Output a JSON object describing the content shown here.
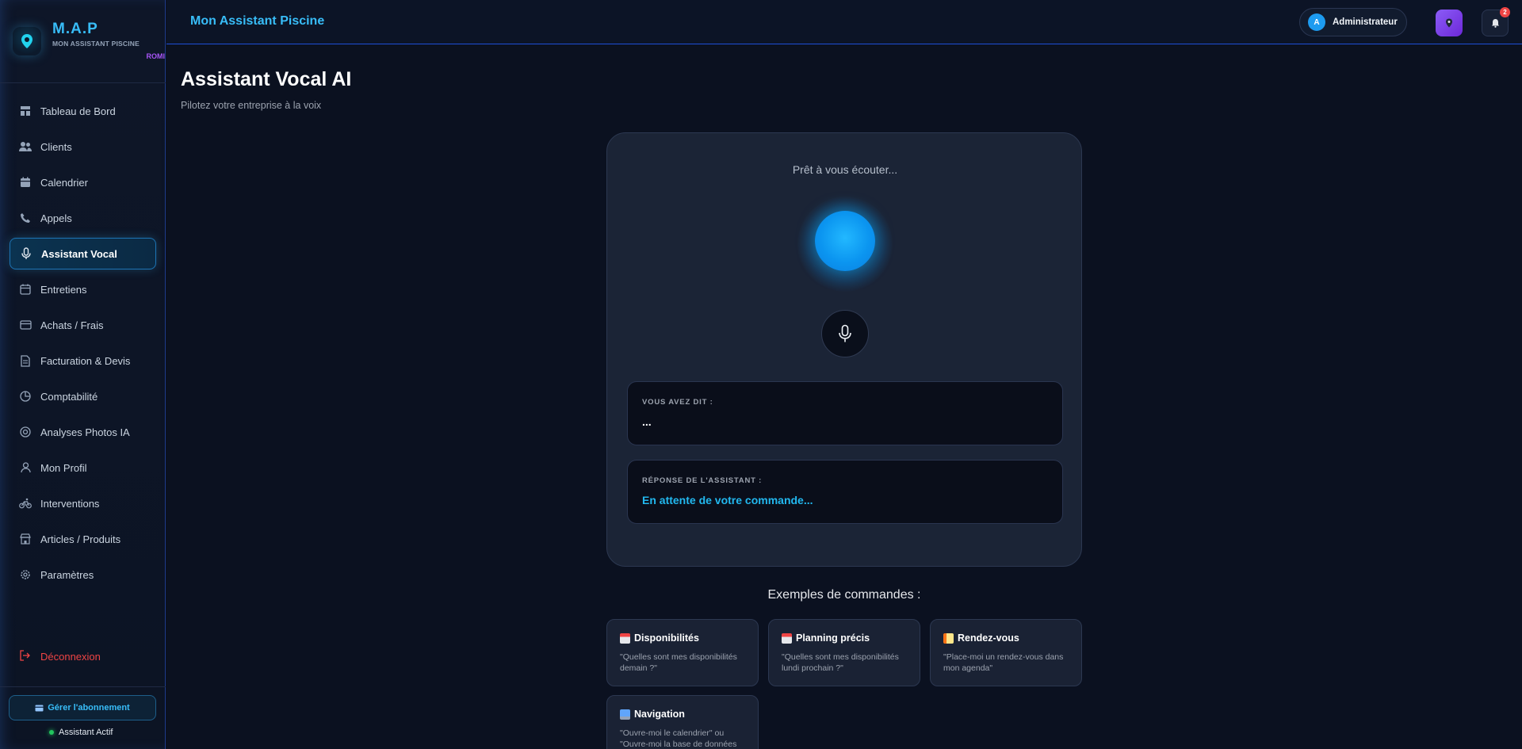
{
  "brand": {
    "title": "M.A.P",
    "subtitle": "MON ASSISTANT PISCINE",
    "tag": "ROMI"
  },
  "sidebar": {
    "items": [
      {
        "label": "Tableau de Bord",
        "icon": "dashboard-icon"
      },
      {
        "label": "Clients",
        "icon": "users-icon"
      },
      {
        "label": "Calendrier",
        "icon": "calendar-icon"
      },
      {
        "label": "Appels",
        "icon": "phone-icon"
      },
      {
        "label": "Assistant Vocal",
        "icon": "microphone-icon",
        "active": true
      },
      {
        "label": "Entretiens",
        "icon": "calendar-grid-icon"
      },
      {
        "label": "Achats / Frais",
        "icon": "credit-card-icon"
      },
      {
        "label": "Facturation & Devis",
        "icon": "document-icon"
      },
      {
        "label": "Comptabilité",
        "icon": "pie-chart-icon"
      },
      {
        "label": "Analyses Photos IA",
        "icon": "target-icon"
      },
      {
        "label": "Mon Profil",
        "icon": "user-icon"
      },
      {
        "label": "Interventions",
        "icon": "bike-icon"
      },
      {
        "label": "Articles / Produits",
        "icon": "store-icon"
      },
      {
        "label": "Paramètres",
        "icon": "gear-icon"
      }
    ],
    "logout": "Déconnexion",
    "subscription_button": "Gérer l'abonnement",
    "status": "Assistant Actif"
  },
  "header": {
    "title": "Mon Assistant Piscine",
    "user_initial": "A",
    "user_name": "Administrateur",
    "notification_count": "2"
  },
  "main": {
    "title": "Assistant Vocal AI",
    "subtitle": "Pilotez votre entreprise à la voix",
    "status_text": "Prêt à vous écouter...",
    "you_said_label": "VOUS AVEZ DIT :",
    "you_said_value": "...",
    "response_label": "RÉPONSE DE L'ASSISTANT :",
    "response_value": "En attente de votre commande...",
    "examples_title": "Exemples de commandes :",
    "examples": [
      {
        "title": "Disponibilités",
        "desc": "\"Quelles sont mes disponibilités demain ?\"",
        "icon": "calendar-emoji-icon"
      },
      {
        "title": "Planning précis",
        "desc": "\"Quelles sont mes disponibilités lundi prochain ?\"",
        "icon": "calendar-emoji-icon"
      },
      {
        "title": "Rendez-vous",
        "desc": "\"Place-moi un rendez-vous dans mon agenda\"",
        "icon": "memo-emoji-icon"
      },
      {
        "title": "Navigation",
        "desc": "\"Ouvre-moi le calendrier\" ou \"Ouvre-moi la base de données",
        "icon": "computer-emoji-icon"
      }
    ]
  },
  "colors": {
    "accent": "#38bdf8",
    "background": "#0b1120",
    "danger": "#ef4444",
    "purple": "#8b5cf6",
    "success": "#22c55e"
  }
}
